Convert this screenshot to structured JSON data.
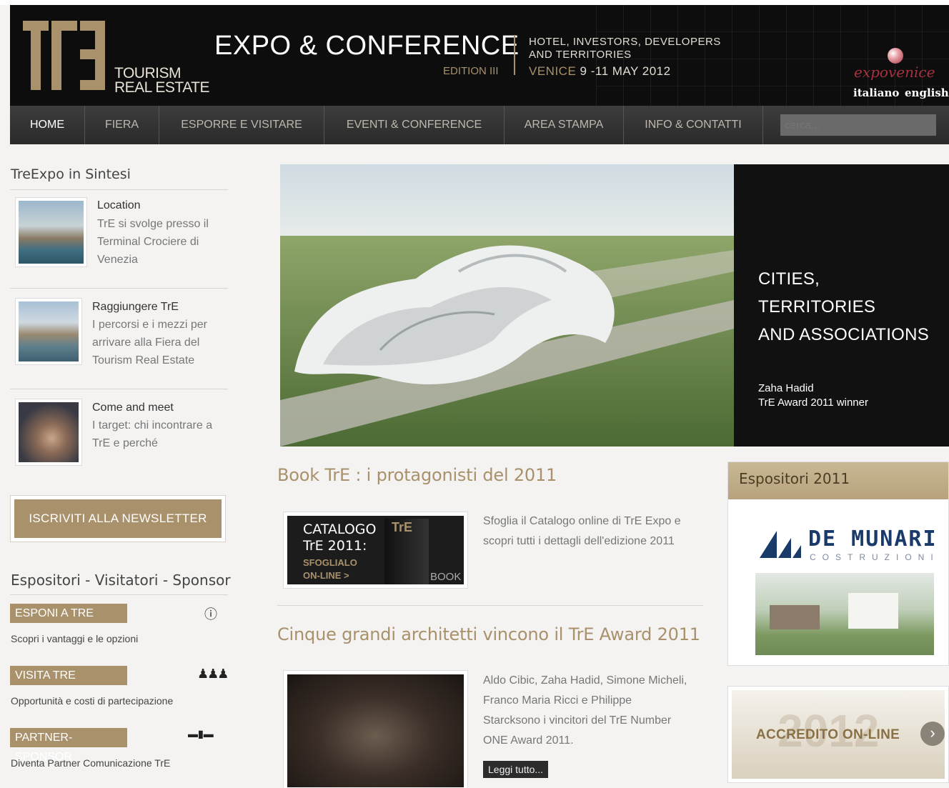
{
  "header": {
    "logo_line1": "TOURISM",
    "logo_line2": "REAL ESTATE",
    "title": "EXPO & CONFERENCE",
    "edition": "EDITION III",
    "tagline_line1": "HOTEL, INVESTORS, DEVELOPERS",
    "tagline_line2": "AND TERRITORIES",
    "venice_city": "VENICE",
    "venice_dates": "9 -11 MAY 2012",
    "partner_brand": "expovenice",
    "lang_it": "italiano",
    "lang_en": "english"
  },
  "nav": {
    "items": [
      "HOME",
      "FIERA",
      "ESPORRE E VISITARE",
      "EVENTI & CONFERENCE",
      "AREA STAMPA",
      "INFO & CONTATTI"
    ],
    "active": "HOME",
    "search_placeholder": "cerca..."
  },
  "sidebar": {
    "title": "TreExpo in Sintesi",
    "items": [
      {
        "title": "Location",
        "text": [
          "TrE si svolge presso il",
          "Terminal Crociere di",
          "Venezia"
        ]
      },
      {
        "title": "Raggiungere TrE",
        "text": [
          "I percorsi e i mezzi per",
          "arrivare alla Fiera del",
          "Tourism Real Estate"
        ]
      },
      {
        "title": "Come and meet",
        "text": [
          "I target: chi incontrare a",
          "TrE e perché"
        ]
      }
    ],
    "newsletter": "ISCRIVITI ALLA NEWSLETTER",
    "section_title": "Espositori - Visitatori - Sponsor",
    "tags": [
      {
        "label": "ESPONI A TRE",
        "desc": "Scopri i vantaggi e le opzioni"
      },
      {
        "label": "VISITA TRE",
        "desc": "Opportunità e costi di partecipazione"
      },
      {
        "label": "PARTNER-SPONSOR",
        "desc": "Diventa Partner Comunicazione TrE"
      }
    ]
  },
  "hero": {
    "line1": "CITIES,",
    "line2": "TERRITORIES",
    "line3": "AND ASSOCIATIONS",
    "caption1": "Zaha Hadid",
    "caption2": "TrE Award 2011 winner"
  },
  "articles": [
    {
      "title": "Book TrE : i protagonisti del 2011",
      "catalog_line1": "CATALOGO",
      "catalog_line2": "TrE 2011:",
      "catalog_line3": "SFOGLIALO",
      "catalog_line4": "ON-LINE >",
      "catalog_book": "BOOK",
      "text": [
        "Sfoglia il Catalogo online di TrE Expo e",
        "scopri tutti i dettagli dell'edizione 2011"
      ]
    },
    {
      "title": "Cinque grandi architetti vincono il TrE Award 2011",
      "text": [
        "Aldo Cibic, Zaha Hadid, Simone Micheli,",
        "Franco Maria Ricci e Philippe",
        "Starcksono i vincitori del TrE Number",
        "ONE Award 2011."
      ],
      "read_more": "Leggi tutto..."
    }
  ],
  "right": {
    "exhibitors_title": "Espositori 2011",
    "exhibitor_name": "DE MUNARI",
    "exhibitor_sub": "COSTRUZIONI",
    "accredito_year": "2012",
    "accredito_label": "ACCREDITO ON-LINE"
  },
  "colors": {
    "accent": "#a8916b",
    "header_bg": "#0d0d0d",
    "nav_bg": "#333333"
  }
}
